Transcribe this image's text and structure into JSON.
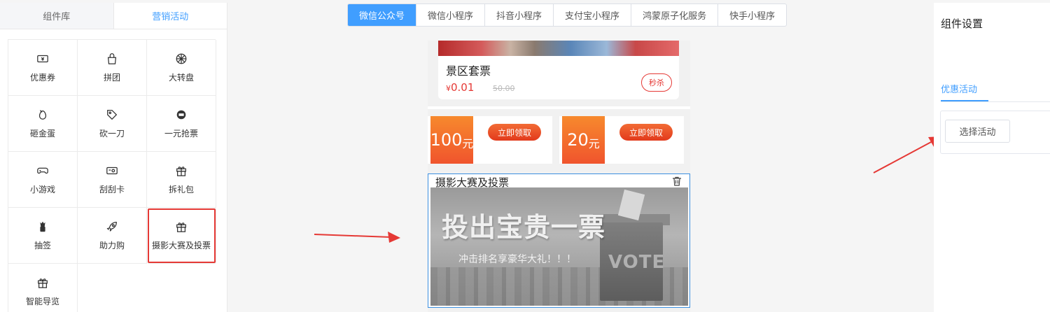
{
  "left_panel": {
    "tabs": [
      {
        "label": "组件库",
        "active": false
      },
      {
        "label": "营销活动",
        "active": true
      }
    ],
    "items": [
      {
        "label": "优惠券",
        "icon": "coupon-icon"
      },
      {
        "label": "拼团",
        "icon": "group-buy-icon"
      },
      {
        "label": "大转盘",
        "icon": "wheel-icon"
      },
      {
        "label": "砸金蛋",
        "icon": "egg-icon"
      },
      {
        "label": "砍一刀",
        "icon": "bargain-icon"
      },
      {
        "label": "一元抢票",
        "icon": "ticket-icon"
      },
      {
        "label": "小游戏",
        "icon": "gamepad-icon"
      },
      {
        "label": "刮刮卡",
        "icon": "scratch-card-icon"
      },
      {
        "label": "拆礼包",
        "icon": "gift-icon"
      },
      {
        "label": "抽签",
        "icon": "lottery-icon"
      },
      {
        "label": "助力购",
        "icon": "rocket-icon"
      },
      {
        "label": "摄影大赛及投票",
        "icon": "gift-icon",
        "highlighted": true
      },
      {
        "label": "智能导览",
        "icon": "gift-icon"
      }
    ]
  },
  "platform_tabs": [
    {
      "label": "微信公众号",
      "active": true
    },
    {
      "label": "微信小程序",
      "active": false
    },
    {
      "label": "抖音小程序",
      "active": false
    },
    {
      "label": "支付宝小程序",
      "active": false
    },
    {
      "label": "鸿蒙原子化服务",
      "active": false
    },
    {
      "label": "快手小程序",
      "active": false
    }
  ],
  "preview": {
    "ticket": {
      "title": "景区套票",
      "currency": "¥",
      "price": "0.01",
      "old_price": "50.00",
      "button": "秒杀"
    },
    "coupons": [
      {
        "amount": "100",
        "unit": "元",
        "button": "立即领取"
      },
      {
        "amount": "20",
        "unit": "元",
        "button": "立即领取"
      }
    ],
    "vote": {
      "title": "摄影大赛及投票",
      "banner_main": "投出宝贵一票",
      "banner_sub": "冲击排名享豪华大礼！！！",
      "banner_box_text": "VOTE"
    }
  },
  "right_panel": {
    "title": "组件设置",
    "tab": "优惠活动",
    "select_button": "选择活动"
  },
  "colors": {
    "accent": "#409eff",
    "highlight_red": "#e53935",
    "coupon_orange": "#f26b35"
  }
}
